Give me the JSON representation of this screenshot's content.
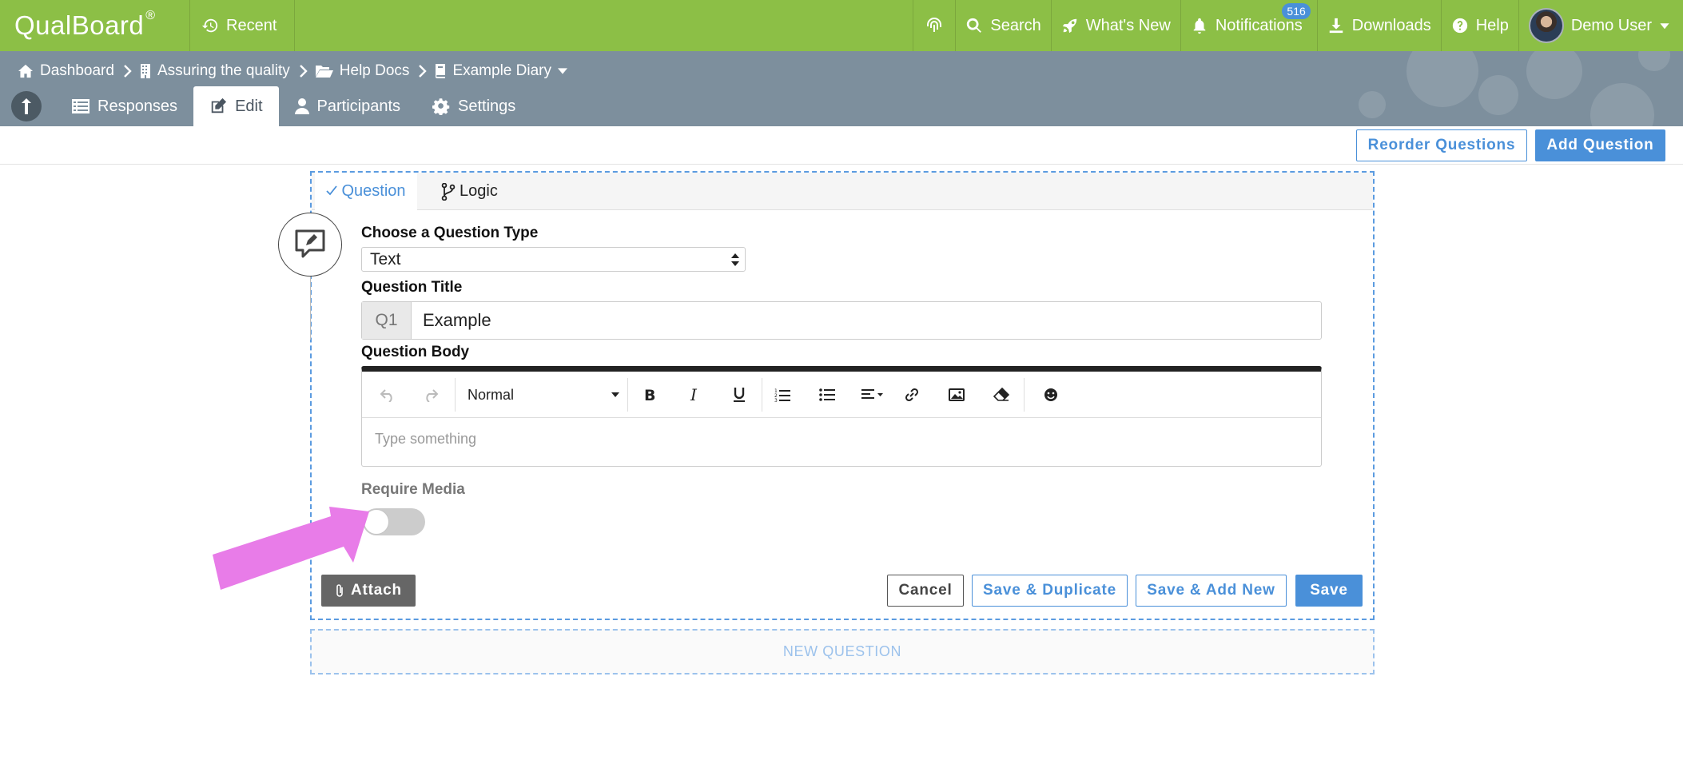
{
  "topbar": {
    "logo": "QualBoard",
    "logo_mark": "®",
    "recent": "Recent",
    "nav": {
      "search": "Search",
      "whats_new": "What's New",
      "notifications": "Notifications",
      "notifications_count": "516",
      "downloads": "Downloads",
      "help": "Help",
      "user": "Demo User"
    }
  },
  "breadcrumb": [
    "Dashboard",
    "Assuring the quality",
    "Help Docs",
    "Example Diary"
  ],
  "tabs": [
    "Responses",
    "Edit",
    "Participants",
    "Settings"
  ],
  "actions": {
    "reorder": "Reorder Questions",
    "add": "Add Question"
  },
  "question": {
    "tabs": [
      "Question",
      "Logic"
    ],
    "type_label": "Choose a Question Type",
    "type_value": "Text",
    "title_label": "Question Title",
    "title_prefix": "Q1",
    "title_value": "Example",
    "body_label": "Question Body",
    "format_value": "Normal",
    "body_placeholder": "Type something",
    "require_media_label": "Require Media",
    "require_media_on": false,
    "buttons": {
      "attach": "Attach",
      "cancel": "Cancel",
      "save_duplicate": "Save & Duplicate",
      "save_add_new": "Save & Add New",
      "save": "Save"
    }
  },
  "new_question": "NEW QUESTION",
  "colors": {
    "topbar": "#8cbf46",
    "subheader": "#7d8f9d",
    "accent": "#4a90d9",
    "annotation_arrow": "#e87ce8"
  }
}
